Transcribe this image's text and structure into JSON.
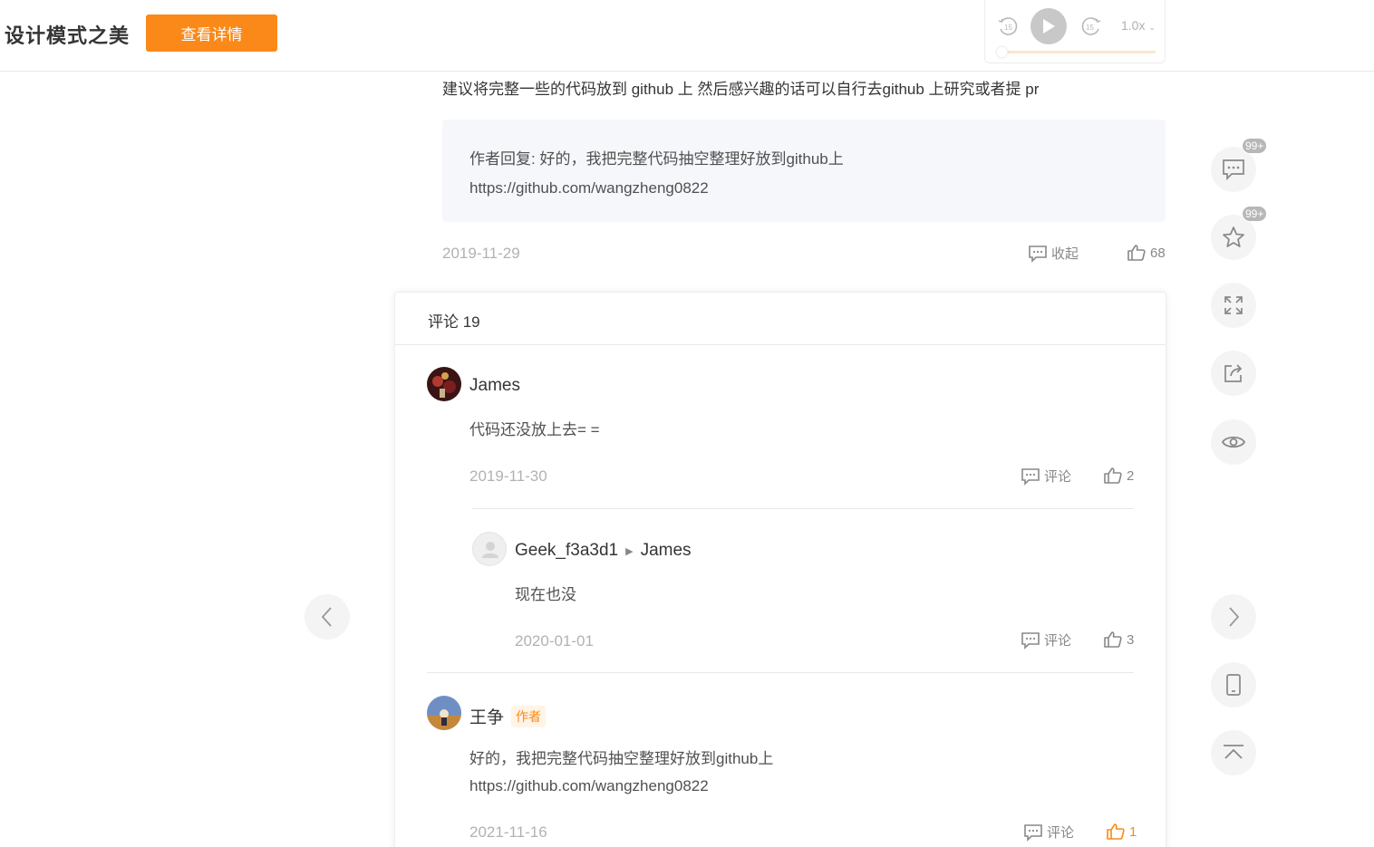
{
  "header": {
    "title": "设计模式之美",
    "detail_button": "查看详情"
  },
  "player": {
    "speed": "1.0x",
    "progress": 0
  },
  "top_comment": {
    "text": "建议将完整一些的代码放到 github 上 然后感兴趣的话可以自行去github 上研究或者提 pr",
    "author_reply_line1": "作者回复: 好的，我把完整代码抽空整理好放到github上",
    "author_reply_line2": "https://github.com/wangzheng0822",
    "date": "2019-11-29",
    "collapse_label": "收起",
    "likes": "68"
  },
  "comments_panel": {
    "title": "评论 19",
    "comments": [
      {
        "username": "James",
        "text": "代码还没放上去= =",
        "date": "2019-11-30",
        "comment_label": "评论",
        "likes": "2"
      },
      {
        "username": "Geek_f3a3d1",
        "reply_to": "James",
        "text": "现在也没",
        "date": "2020-01-01",
        "comment_label": "评论",
        "likes": "3"
      },
      {
        "username": "王争",
        "badge": "作者",
        "text_line1": "好的，我把完整代码抽空整理好放到github上",
        "text_line2": "https://github.com/wangzheng0822",
        "date": "2021-11-16",
        "comment_label": "评论",
        "likes": "1"
      }
    ]
  },
  "sidebar": {
    "comment_count_badge": "99+",
    "favorite_count_badge": "99+"
  },
  "colors": {
    "accent": "#fa8919",
    "text": "#353535",
    "muted": "#b2b2b2",
    "reply_bg": "#f6f7fb"
  }
}
